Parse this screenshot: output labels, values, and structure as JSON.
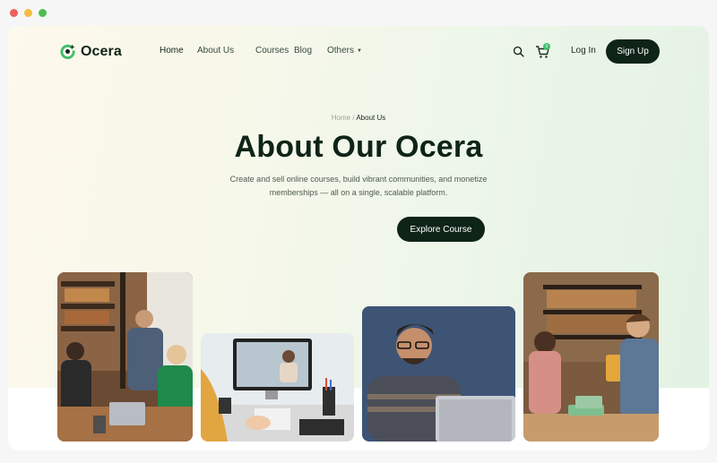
{
  "window": {
    "controls": [
      "close",
      "minimize",
      "maximize"
    ]
  },
  "brand": {
    "name": "Ocera",
    "accent": "#3fbf6a",
    "dark": "#0e2417"
  },
  "nav": {
    "items": [
      {
        "label": "Home",
        "active": true
      },
      {
        "label": "About Us"
      },
      {
        "label": "Courses"
      },
      {
        "label": "Blog"
      },
      {
        "label": "Others",
        "has_dropdown": true
      }
    ],
    "search_icon": "search-icon",
    "cart_icon": "cart-icon",
    "cart_count": "0",
    "login_label": "Log In",
    "signup_label": "Sign Up"
  },
  "hero": {
    "breadcrumb": {
      "home": "Home",
      "separator": "/",
      "current": "About Us"
    },
    "title": "About Our Ocera",
    "subtitle": "Create and sell online courses, build vibrant communities, and monetize memberships — all on a single, scalable platform.",
    "cta_label": "Explore Course"
  },
  "gallery": [
    {
      "scene": "students-library-laptop"
    },
    {
      "scene": "video-call-desk"
    },
    {
      "scene": "student-smiling-laptop"
    },
    {
      "scene": "students-library-tablet"
    }
  ]
}
